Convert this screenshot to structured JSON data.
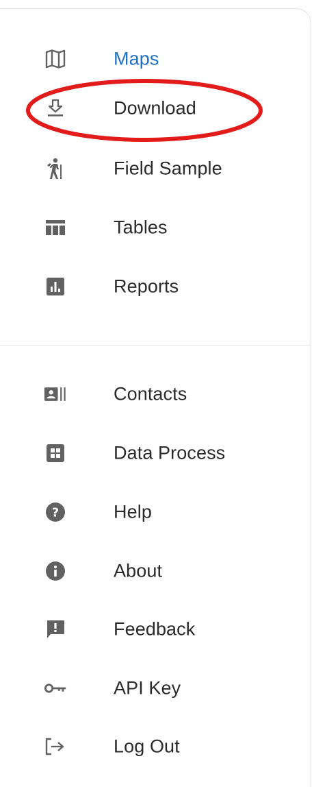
{
  "nav": {
    "primary": [
      {
        "label": "Maps",
        "icon": "map-icon",
        "active": true
      },
      {
        "label": "Download",
        "icon": "download-icon"
      },
      {
        "label": "Field Sample",
        "icon": "hiking-icon"
      },
      {
        "label": "Tables",
        "icon": "table-icon"
      },
      {
        "label": "Reports",
        "icon": "report-chart-icon"
      }
    ],
    "secondary": [
      {
        "label": "Contacts",
        "icon": "contacts-card-icon"
      },
      {
        "label": "Data Process",
        "icon": "grid-icon"
      },
      {
        "label": "Help",
        "icon": "help-circle-icon"
      },
      {
        "label": "About",
        "icon": "info-circle-icon"
      },
      {
        "label": "Feedback",
        "icon": "feedback-icon"
      },
      {
        "label": "API Key",
        "icon": "key-icon"
      },
      {
        "label": "Log Out",
        "icon": "logout-icon"
      }
    ]
  },
  "colors": {
    "active_text": "#1d6fc7",
    "text": "#2a2a2a",
    "icon": "#616161",
    "annotation": "#e31b1b"
  }
}
